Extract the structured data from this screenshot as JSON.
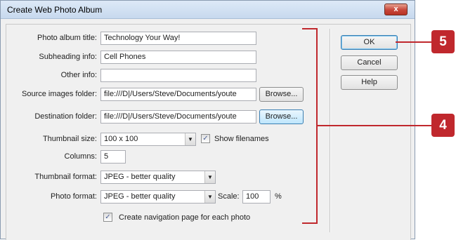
{
  "window": {
    "title": "Create Web Photo Album",
    "close_label": "x"
  },
  "form": {
    "photo_album_title": {
      "label": "Photo album title:",
      "value": "Technology Your Way!"
    },
    "subheading_info": {
      "label": "Subheading info:",
      "value": "Cell Phones"
    },
    "other_info": {
      "label": "Other info:",
      "value": ""
    },
    "source_folder": {
      "label": "Source images folder:",
      "value": "file:///D|/Users/Steve/Documents/youte",
      "browse_label": "Browse..."
    },
    "destination_folder": {
      "label": "Destination folder:",
      "value": "file:///D|/Users/Steve/Documents/youte",
      "browse_label": "Browse..."
    },
    "thumbnail_size": {
      "label": "Thumbnail size:",
      "selected": "100 x 100"
    },
    "show_filenames": {
      "label": "Show filenames",
      "checked": true
    },
    "columns": {
      "label": "Columns:",
      "value": "5"
    },
    "thumbnail_format": {
      "label": "Thumbnail format:",
      "selected": "JPEG - better quality"
    },
    "photo_format": {
      "label": "Photo format:",
      "selected": "JPEG - better quality"
    },
    "scale": {
      "label": "Scale:",
      "value": "100",
      "unit": "%"
    },
    "create_nav": {
      "label": "Create navigation page for each photo",
      "checked": true
    }
  },
  "buttons": {
    "ok": "OK",
    "cancel": "Cancel",
    "help": "Help"
  },
  "callouts": {
    "step_5": "5",
    "step_4": "4",
    "color": "#c0282d"
  }
}
